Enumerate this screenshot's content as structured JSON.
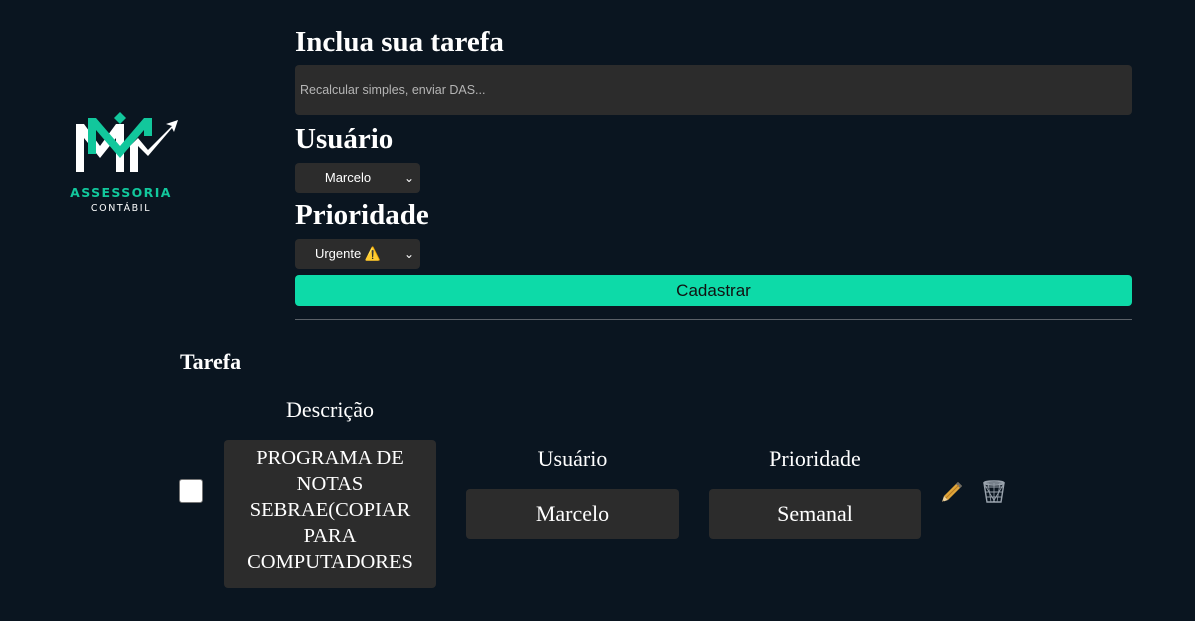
{
  "logo": {
    "title": "ASSESSORIA",
    "subtitle": "CONTÁBIL",
    "icon": "mm-chart-arrow-logo",
    "brand_color": "#12c79c"
  },
  "form": {
    "task_label": "Inclua sua tarefa",
    "task_placeholder": "Recalcular simples, enviar DAS...",
    "task_value": "",
    "user_label": "Usuário",
    "user_selected": "Marcelo",
    "priority_label": "Prioridade",
    "priority_selected": "Urgente",
    "priority_icon": "⚠️",
    "submit_label": "Cadastrar",
    "accent_color": "#0ddaa8"
  },
  "list": {
    "title": "Tarefa",
    "headers": {
      "description": "Descrição",
      "user": "Usuário",
      "priority": "Prioridade"
    },
    "tasks": [
      {
        "checked": false,
        "description": "PROGRAMA DE NOTAS SEBRAE(COPIAR PARA COMPUTADORES",
        "user": "Marcelo",
        "priority": "Semanal",
        "edit_icon": "pencil-icon",
        "delete_icon": "trash-icon"
      }
    ]
  },
  "colors": {
    "background": "#0a1520",
    "field_background": "#2c2c2c"
  }
}
